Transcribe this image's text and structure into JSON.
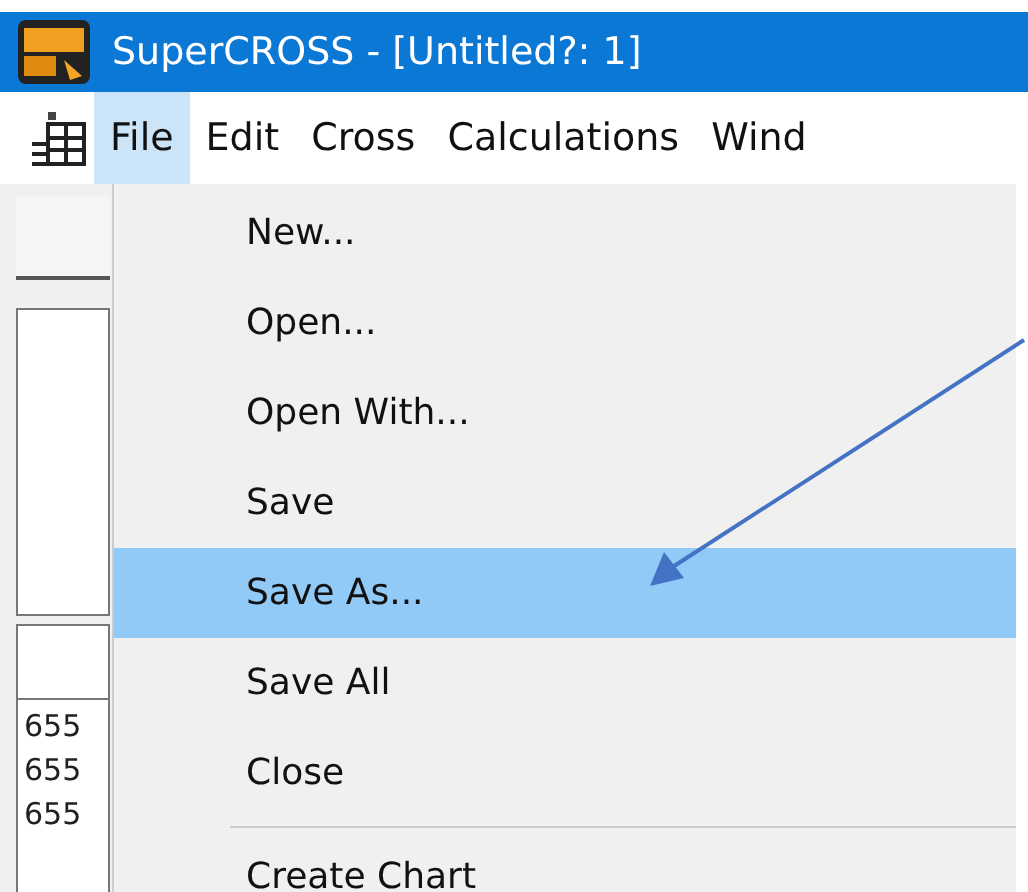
{
  "window": {
    "title": "SuperCROSS - [Untitled?: 1]"
  },
  "menu_bar": [
    {
      "label": "File",
      "selected": true
    },
    {
      "label": "Edit",
      "selected": false
    },
    {
      "label": "Cross",
      "selected": false
    },
    {
      "label": "Calculations",
      "selected": false
    },
    {
      "label": "Wind",
      "selected": false
    }
  ],
  "file_menu": [
    {
      "kind": "item",
      "label": "New...",
      "selected": false
    },
    {
      "kind": "item",
      "label": "Open...",
      "selected": false
    },
    {
      "kind": "item",
      "label": "Open With...",
      "selected": false
    },
    {
      "kind": "item",
      "label": "Save",
      "selected": false
    },
    {
      "kind": "item",
      "label": "Save As...",
      "selected": true
    },
    {
      "kind": "item",
      "label": "Save All",
      "selected": false
    },
    {
      "kind": "item",
      "label": "Close",
      "selected": false
    },
    {
      "kind": "separator"
    },
    {
      "kind": "item",
      "label": "Create Chart",
      "selected": false
    }
  ],
  "background_list": [
    "655",
    "655",
    "655"
  ]
}
